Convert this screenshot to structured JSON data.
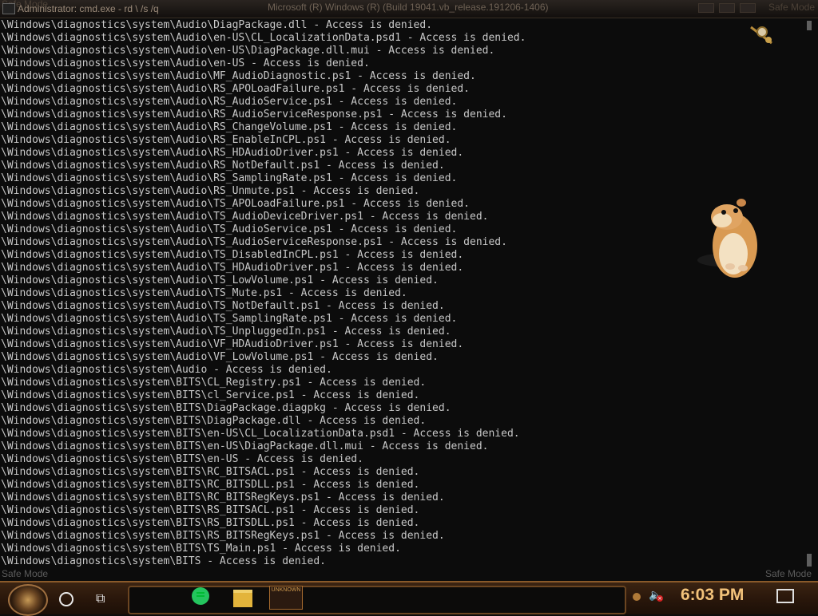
{
  "window": {
    "title": "Administrator: cmd.exe - rd \\ /s /q",
    "center_title": "Microsoft (R) Windows (R) (Build 19041.vb_release.191206-1406)",
    "safe_mode_top_left": "Safe Mode",
    "safe_mode_top_right": "Safe Mode"
  },
  "console": {
    "lines": [
      "\\Windows\\diagnostics\\system\\Audio\\DiagPackage.dll - Access is denied.",
      "\\Windows\\diagnostics\\system\\Audio\\en-US\\CL_LocalizationData.psd1 - Access is denied.",
      "\\Windows\\diagnostics\\system\\Audio\\en-US\\DiagPackage.dll.mui - Access is denied.",
      "\\Windows\\diagnostics\\system\\Audio\\en-US - Access is denied.",
      "\\Windows\\diagnostics\\system\\Audio\\MF_AudioDiagnostic.ps1 - Access is denied.",
      "\\Windows\\diagnostics\\system\\Audio\\RS_APOLoadFailure.ps1 - Access is denied.",
      "\\Windows\\diagnostics\\system\\Audio\\RS_AudioService.ps1 - Access is denied.",
      "\\Windows\\diagnostics\\system\\Audio\\RS_AudioServiceResponse.ps1 - Access is denied.",
      "\\Windows\\diagnostics\\system\\Audio\\RS_ChangeVolume.ps1 - Access is denied.",
      "\\Windows\\diagnostics\\system\\Audio\\RS_EnableInCPL.ps1 - Access is denied.",
      "\\Windows\\diagnostics\\system\\Audio\\RS_HDAudioDriver.ps1 - Access is denied.",
      "\\Windows\\diagnostics\\system\\Audio\\RS_NotDefault.ps1 - Access is denied.",
      "\\Windows\\diagnostics\\system\\Audio\\RS_SamplingRate.ps1 - Access is denied.",
      "\\Windows\\diagnostics\\system\\Audio\\RS_Unmute.ps1 - Access is denied.",
      "\\Windows\\diagnostics\\system\\Audio\\TS_APOLoadFailure.ps1 - Access is denied.",
      "\\Windows\\diagnostics\\system\\Audio\\TS_AudioDeviceDriver.ps1 - Access is denied.",
      "\\Windows\\diagnostics\\system\\Audio\\TS_AudioService.ps1 - Access is denied.",
      "\\Windows\\diagnostics\\system\\Audio\\TS_AudioServiceResponse.ps1 - Access is denied.",
      "\\Windows\\diagnostics\\system\\Audio\\TS_DisabledInCPL.ps1 - Access is denied.",
      "\\Windows\\diagnostics\\system\\Audio\\TS_HDAudioDriver.ps1 - Access is denied.",
      "\\Windows\\diagnostics\\system\\Audio\\TS_LowVolume.ps1 - Access is denied.",
      "\\Windows\\diagnostics\\system\\Audio\\TS_Mute.ps1 - Access is denied.",
      "\\Windows\\diagnostics\\system\\Audio\\TS_NotDefault.ps1 - Access is denied.",
      "\\Windows\\diagnostics\\system\\Audio\\TS_SamplingRate.ps1 - Access is denied.",
      "\\Windows\\diagnostics\\system\\Audio\\TS_UnpluggedIn.ps1 - Access is denied.",
      "\\Windows\\diagnostics\\system\\Audio\\VF_HDAudioDriver.ps1 - Access is denied.",
      "\\Windows\\diagnostics\\system\\Audio\\VF_LowVolume.ps1 - Access is denied.",
      "\\Windows\\diagnostics\\system\\Audio - Access is denied.",
      "\\Windows\\diagnostics\\system\\BITS\\CL_Registry.ps1 - Access is denied.",
      "\\Windows\\diagnostics\\system\\BITS\\cl_Service.ps1 - Access is denied.",
      "\\Windows\\diagnostics\\system\\BITS\\DiagPackage.diagpkg - Access is denied.",
      "\\Windows\\diagnostics\\system\\BITS\\DiagPackage.dll - Access is denied.",
      "\\Windows\\diagnostics\\system\\BITS\\en-US\\CL_LocalizationData.psd1 - Access is denied.",
      "\\Windows\\diagnostics\\system\\BITS\\en-US\\DiagPackage.dll.mui - Access is denied.",
      "\\Windows\\diagnostics\\system\\BITS\\en-US - Access is denied.",
      "\\Windows\\diagnostics\\system\\BITS\\RC_BITSACL.ps1 - Access is denied.",
      "\\Windows\\diagnostics\\system\\BITS\\RC_BITSDLL.ps1 - Access is denied.",
      "\\Windows\\diagnostics\\system\\BITS\\RC_BITSRegKeys.ps1 - Access is denied.",
      "\\Windows\\diagnostics\\system\\BITS\\RS_BITSACL.ps1 - Access is denied.",
      "\\Windows\\diagnostics\\system\\BITS\\RS_BITSDLL.ps1 - Access is denied.",
      "\\Windows\\diagnostics\\system\\BITS\\RS_BITSRegKeys.ps1 - Access is denied.",
      "\\Windows\\diagnostics\\system\\BITS\\TS_Main.ps1 - Access is denied.",
      "\\Windows\\diagnostics\\system\\BITS - Access is denied."
    ],
    "safe_mode_bottom_left": "Safe Mode",
    "safe_mode_bottom_right": "Safe Mode"
  },
  "taskbar": {
    "clock": "6:03 PM",
    "pinned_app_label": "UNKNOWN"
  },
  "colors": {
    "console_bg": "#0c0c0c",
    "console_text": "#c8c8c8",
    "clock": "#f2c27a",
    "taskbar_accent": "#8a5a2a"
  }
}
